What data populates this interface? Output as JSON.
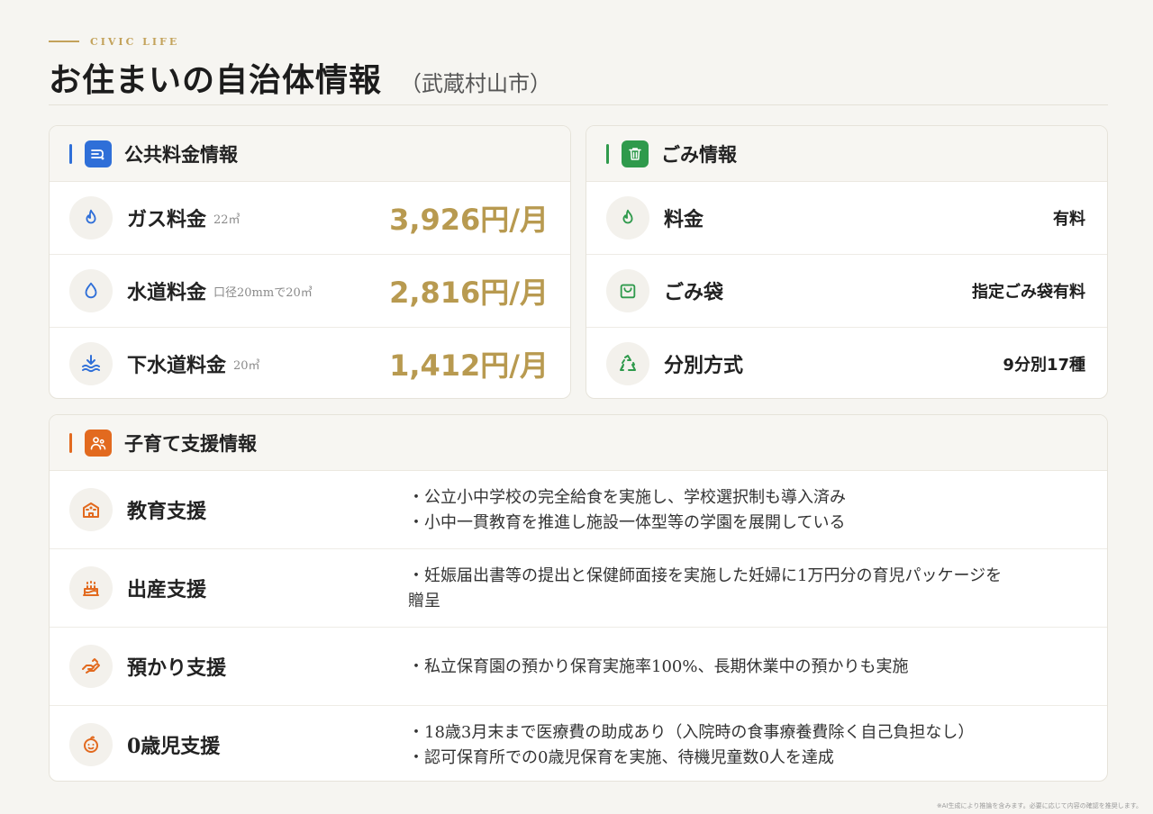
{
  "header": {
    "eyebrow": "CIVIC LIFE",
    "title": "お住まいの自治体情報",
    "subtitle": "（武蔵村山市）"
  },
  "colors": {
    "gold": "#b89a50",
    "blue": "#2f6fd8",
    "green": "#2f9a4c",
    "orange": "#e26a1f"
  },
  "utilities": {
    "title": "公共料金情報",
    "icon": "water-tap-icon",
    "rows": [
      {
        "icon": "flame-icon",
        "label": "ガス料金",
        "note": "22㎥",
        "value": "3,926円/月"
      },
      {
        "icon": "droplet-icon",
        "label": "水道料金",
        "note": "口径20mmで20㎥",
        "value": "2,816円/月"
      },
      {
        "icon": "sewer-icon",
        "label": "下水道料金",
        "note": "20㎥",
        "value": "1,412円/月"
      }
    ]
  },
  "garbage": {
    "title": "ごみ情報",
    "icon": "trash-icon",
    "rows": [
      {
        "icon": "flame-icon",
        "label": "料金",
        "value": "有料"
      },
      {
        "icon": "bag-icon",
        "label": "ごみ袋",
        "value": "指定ごみ袋有料"
      },
      {
        "icon": "recycle-icon",
        "label": "分別方式",
        "value": "9分別17種"
      }
    ]
  },
  "childcare": {
    "title": "子育て支援情報",
    "icon": "family-icon",
    "rows": [
      {
        "icon": "school-icon",
        "label": "教育支援",
        "lines": [
          "・公立小中学校の完全給食を実施し、学校選択制も導入済み",
          "・小中一貫教育を推進し施設一体型等の学園を展開している"
        ]
      },
      {
        "icon": "cake-icon",
        "label": "出産支援",
        "lines": [
          "・妊娠届出書等の提出と保健師面接を実施した妊婦に1万円分の育児パッケージを",
          "贈呈"
        ]
      },
      {
        "icon": "hand-icon",
        "label": "預かり支援",
        "lines": [
          "・私立保育園の預かり保育実施率100%、長期休業中の預かりも実施"
        ]
      },
      {
        "icon": "baby-icon",
        "label": "0歳児支援",
        "lines": [
          "・18歳3月末まで医療費の助成あり（入院時の食事療養費除く自己負担なし）",
          "・認可保育所での0歳児保育を実施、待機児童数0人を達成"
        ]
      }
    ]
  },
  "footer": "※AI生成により推論を含みます。必要に応じて内容の確認を推奨します。"
}
